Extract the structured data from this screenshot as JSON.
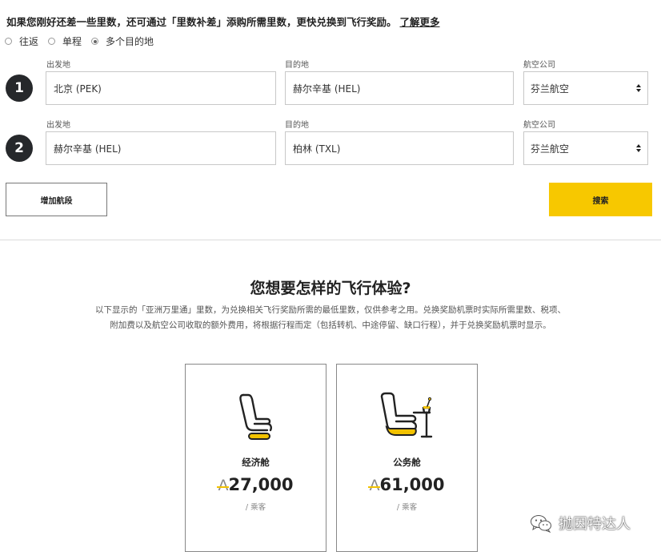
{
  "notice": {
    "text": "如果您刚好还差一些里数，还可通过「里数补差」添购所需里数，更快兑换到飞行奖励。",
    "link": "了解更多"
  },
  "trip_types": [
    {
      "label": "往返",
      "selected": false
    },
    {
      "label": "单程",
      "selected": false
    },
    {
      "label": "多个目的地",
      "selected": true
    }
  ],
  "segments": [
    {
      "number": "1",
      "origin_label": "出发地",
      "origin_value": "北京 (PEK)",
      "destination_label": "目的地",
      "destination_value": "赫尔辛基 (HEL)",
      "airline_label": "航空公司",
      "airline_value": "芬兰航空"
    },
    {
      "number": "2",
      "origin_label": "出发地",
      "origin_value": "赫尔辛基 (HEL)",
      "destination_label": "目的地",
      "destination_value": "柏林 (TXL)",
      "airline_label": "航空公司",
      "airline_value": "芬兰航空"
    }
  ],
  "buttons": {
    "add_segment": "增加航段",
    "search": "搜索"
  },
  "experience": {
    "title": "您想要怎样的飞行体验?",
    "desc_line1": "以下显示的「亚洲万里通」里数，为兑换相关飞行奖励所需的最低里数，仅供参考之用。兑换奖励机票时实际所需里数、税项、",
    "desc_line2": "附加费以及航空公司收取的额外费用，将根据行程而定（包括转机、中途停留、缺口行程），并于兑换奖励机票时显示。"
  },
  "cabins": [
    {
      "name": "经济舱",
      "currency": "A",
      "miles": "27,000",
      "per": "/ 乘客",
      "icon": "economy-seat-icon"
    },
    {
      "name": "公务舱",
      "currency": "A",
      "miles": "61,000",
      "per": "/ 乘客",
      "icon": "business-seat-icon"
    }
  ],
  "watermark": {
    "text": "抛因特达人"
  },
  "colors": {
    "accent_yellow": "#f7c800",
    "badge_dark": "#26282b"
  }
}
